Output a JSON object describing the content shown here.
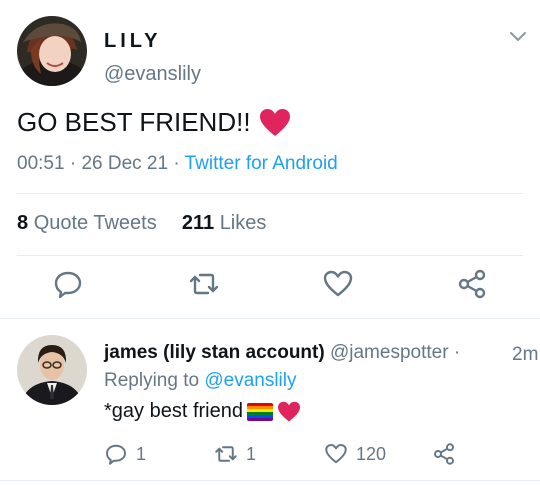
{
  "tweet": {
    "display_name": "LILY",
    "handle": "@evanslily",
    "text": "GO BEST FRIEND!!",
    "time": "00:51",
    "date": "26 Dec 21",
    "source": "Twitter for Android",
    "quote_count": "8",
    "quote_label": "Quote Tweets",
    "like_count": "211",
    "like_label": "Likes"
  },
  "reply": {
    "display_name": "james (lily stan account)",
    "handle": "@jamespotter",
    "time_sep": "·",
    "time": "2m",
    "replying_label": "Replying to",
    "replying_to": "@evanslily",
    "text": "*gay best friend",
    "reply_count": "1",
    "retweet_count": "1",
    "like_count": "120"
  },
  "icons": {
    "chevron": "chevron-down-icon",
    "reply": "comment-bubble-icon",
    "retweet": "retweet-icon",
    "like": "heart-outline-icon",
    "share": "share-icon"
  },
  "colors": {
    "link": "#1da1f2",
    "secondary_text": "#657786",
    "primary_text": "#0f1419",
    "divider": "#e6ecf0",
    "heart_emoji": "#e0245e"
  }
}
